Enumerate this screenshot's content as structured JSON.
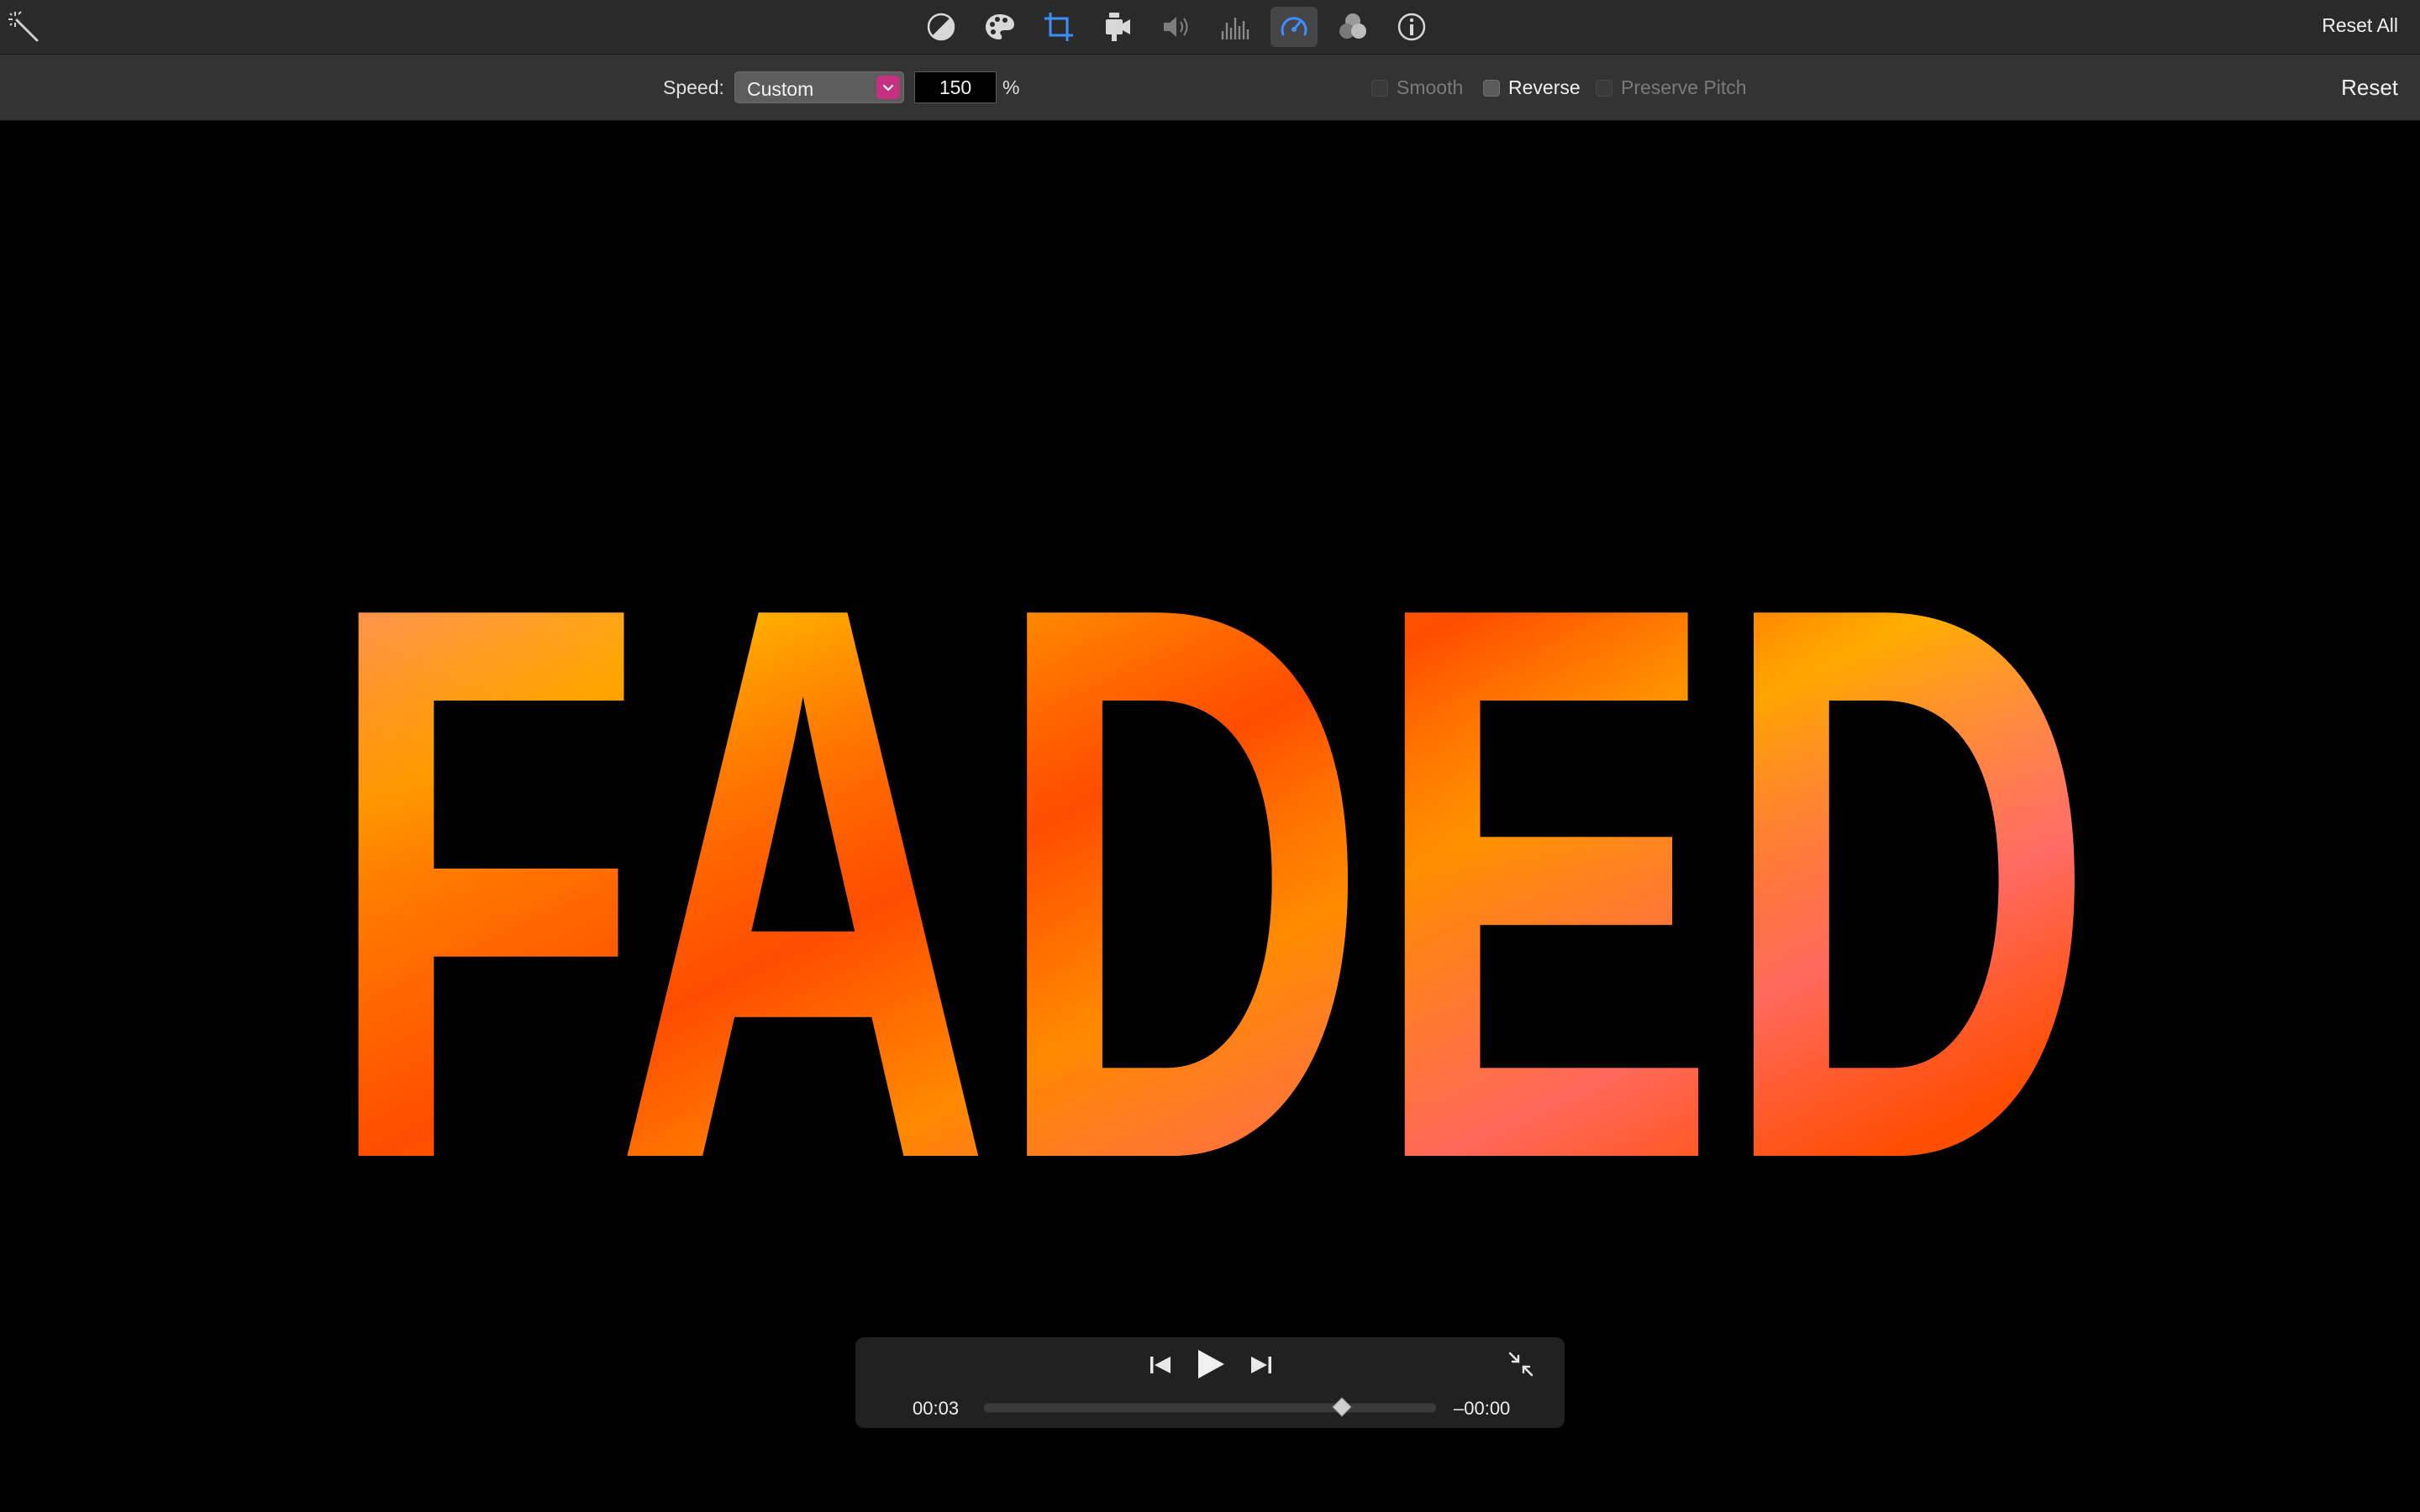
{
  "toolbar": {
    "reset_all_label": "Reset All",
    "tools": [
      {
        "name": "color-balance-icon",
        "active": false
      },
      {
        "name": "color-correction-icon",
        "active": false
      },
      {
        "name": "crop-icon",
        "active": false
      },
      {
        "name": "stabilization-icon",
        "active": false
      },
      {
        "name": "volume-icon",
        "active": false
      },
      {
        "name": "noise-reduction-icon",
        "active": false
      },
      {
        "name": "speed-icon",
        "active": true
      },
      {
        "name": "clip-filter-icon",
        "active": false
      },
      {
        "name": "info-icon",
        "active": false
      }
    ]
  },
  "speed_controls": {
    "speed_label": "Speed:",
    "speed_value": "Custom",
    "percent_value": "150",
    "percent_unit": "%",
    "smooth_label": "Smooth",
    "reverse_label": "Reverse",
    "preserve_pitch_label": "Preserve Pitch",
    "reset_label": "Reset"
  },
  "viewer": {
    "title_text": "FADED",
    "colors": {
      "pink": "#ff84b3",
      "yellow": "#ffc400",
      "orange": "#ff4d00"
    }
  },
  "playback": {
    "elapsed": "00:03",
    "remaining": "–00:00",
    "progress_fraction": 0.79
  },
  "colors": {
    "accent_blue": "#3d8fff",
    "speed_dropdown_accent": "#c4317f"
  }
}
